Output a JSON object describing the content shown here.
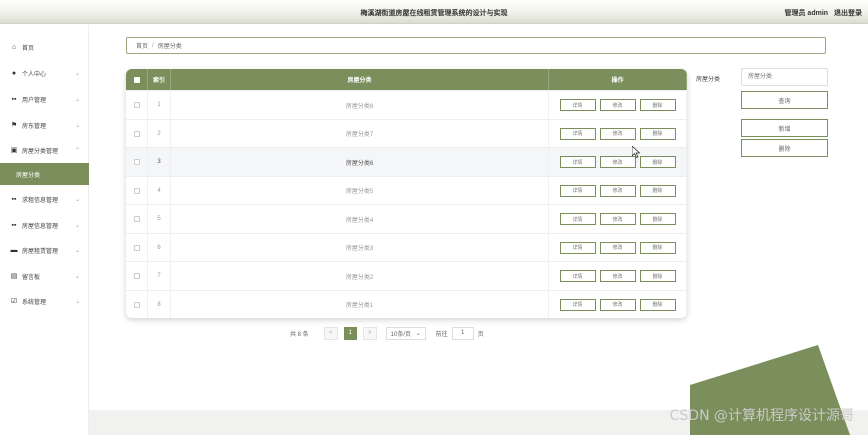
{
  "app": {
    "title": "梅溪湖街道房屋在线租赁管理系统的设计与实现",
    "user_label": "管理员 admin",
    "logout_label": "退出登录"
  },
  "sidebar": {
    "items": [
      {
        "label": "首页",
        "icon": "home-icon",
        "has_chevron": false
      },
      {
        "label": "个人中心",
        "icon": "user-icon",
        "has_chevron": true
      },
      {
        "label": "用户管理",
        "icon": "grid-icon",
        "has_chevron": true
      },
      {
        "label": "房东管理",
        "icon": "flag-icon",
        "has_chevron": true
      },
      {
        "label": "房屋分类管理",
        "icon": "folder-icon",
        "has_chevron": true,
        "expanded": true
      },
      {
        "label": "房屋分类",
        "icon": "",
        "has_chevron": false,
        "active": true
      },
      {
        "label": "求租信息管理",
        "icon": "grid-icon",
        "has_chevron": true
      },
      {
        "label": "房屋信息管理",
        "icon": "grid-icon",
        "has_chevron": true
      },
      {
        "label": "房屋租赁管理",
        "icon": "car-icon",
        "has_chevron": true
      },
      {
        "label": "留言板",
        "icon": "doc-icon",
        "has_chevron": true
      },
      {
        "label": "系统管理",
        "icon": "check-icon",
        "has_chevron": true
      }
    ]
  },
  "breadcrumb": {
    "home": "首页",
    "separator": "/",
    "current": "房屋分类"
  },
  "table": {
    "headers": {
      "index": "索引",
      "name": "房屋分类",
      "ops": "操作"
    },
    "rows": [
      {
        "index": "1",
        "name": "房屋分类8"
      },
      {
        "index": "2",
        "name": "房屋分类7"
      },
      {
        "index": "3",
        "name": "房屋分类6",
        "highlight": true
      },
      {
        "index": "4",
        "name": "房屋分类5"
      },
      {
        "index": "5",
        "name": "房屋分类4"
      },
      {
        "index": "6",
        "name": "房屋分类3"
      },
      {
        "index": "7",
        "name": "房屋分类2"
      },
      {
        "index": "8",
        "name": "房屋分类1"
      }
    ],
    "ops": {
      "detail": "详情",
      "edit": "修改",
      "delete": "删除"
    }
  },
  "search": {
    "label": "房屋分类",
    "placeholder": "房屋分类",
    "search_button": "查询",
    "add_button": "新增",
    "delete_button": "删除"
  },
  "pagination": {
    "total": "共 8 条",
    "prev": "<",
    "current": "1",
    "next": ">",
    "page_size": "10条/页",
    "goto_label": "前往",
    "goto_value": "1",
    "page_suffix": "页"
  },
  "watermark": "CSDN @计算机程序设计源哥",
  "colors": {
    "accent": "#7b8f5c"
  }
}
